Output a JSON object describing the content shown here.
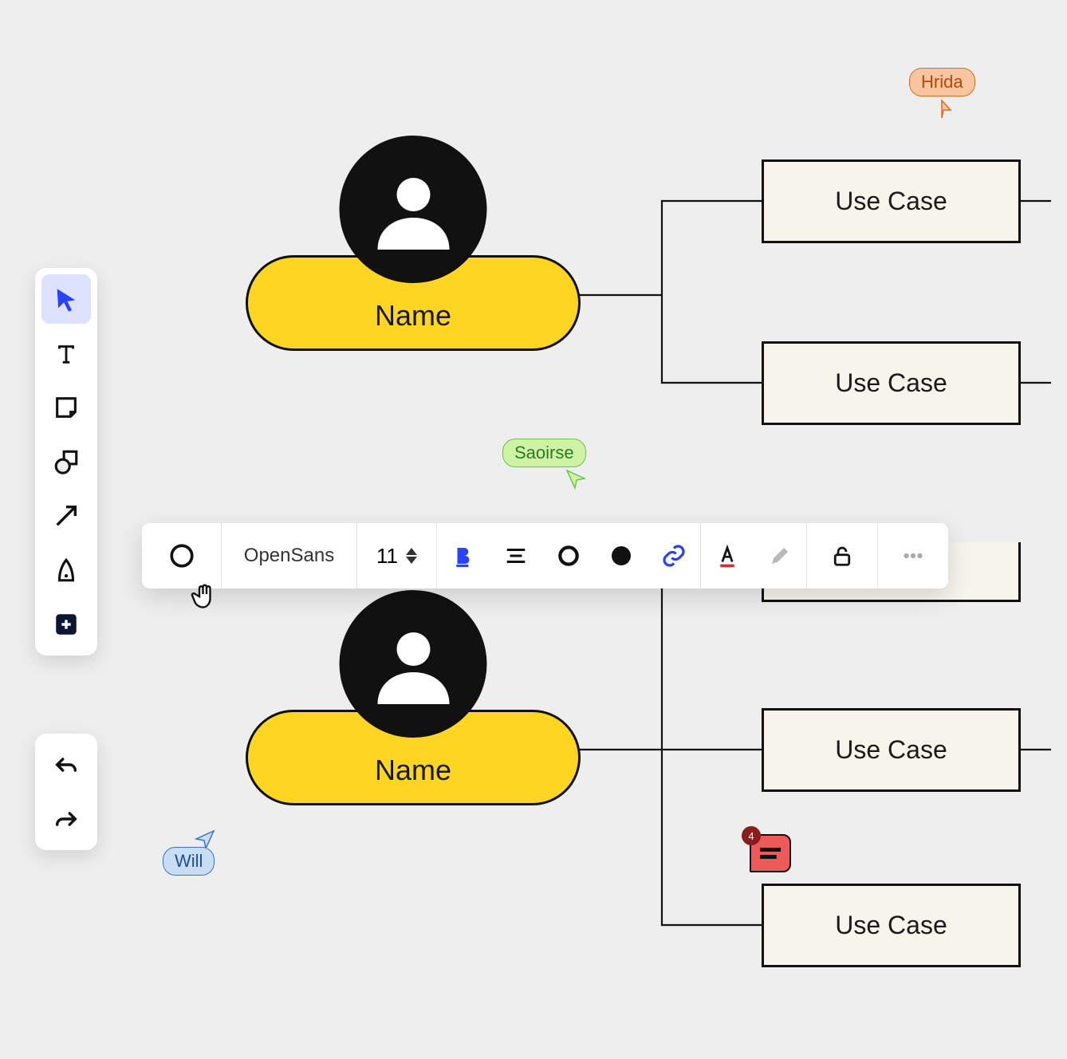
{
  "actors": [
    {
      "label": "Name"
    },
    {
      "label": "Name"
    }
  ],
  "usecases": [
    {
      "label": "Use Case"
    },
    {
      "label": "Use Case"
    },
    {
      "label": "Use Case"
    },
    {
      "label": "Use Case"
    },
    {
      "label": "Use Case"
    }
  ],
  "collaborators": {
    "hrida": {
      "label": "Hrida",
      "bg": "#f7c59f",
      "border": "#e06a1f",
      "text": "#b24a0b"
    },
    "saoirse": {
      "label": "Saoirse",
      "bg": "#cef3a5",
      "border": "#6cc24a",
      "text": "#2c7a24"
    },
    "will": {
      "label": "Will",
      "bg": "#c9ddf5",
      "border": "#3a73c7",
      "text": "#1e4d97"
    }
  },
  "format": {
    "font": "OpenSans",
    "size": "11"
  },
  "comment": {
    "count": "4"
  }
}
